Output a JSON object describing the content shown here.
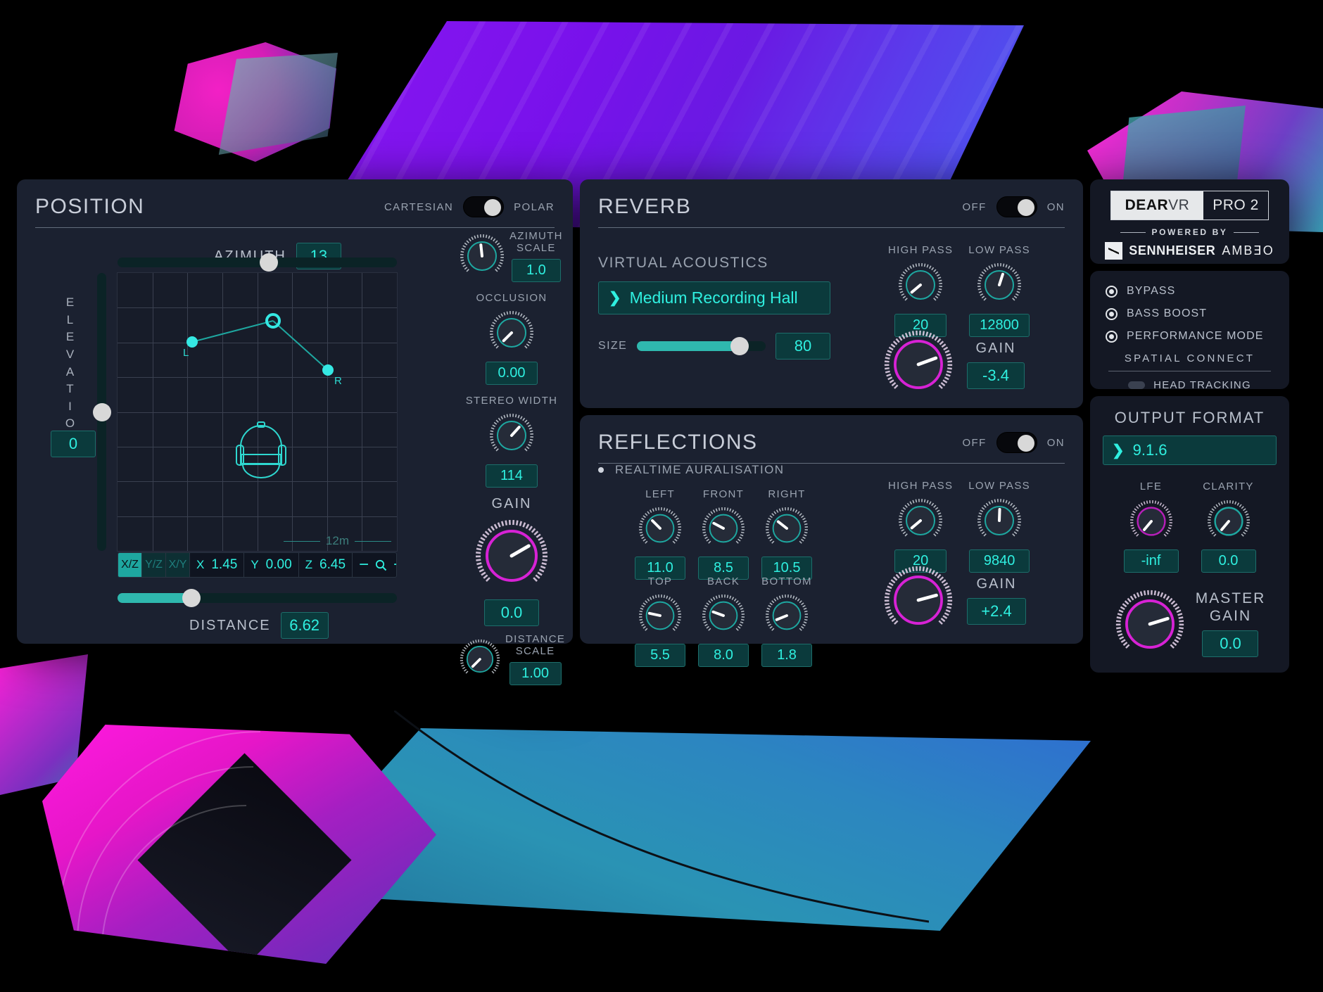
{
  "position": {
    "title": "POSITION",
    "mode_left": "CARTESIAN",
    "mode_right": "POLAR",
    "azimuth_label": "AZIMUTH",
    "azimuth_value": "13",
    "elevation_label": "ELEVATION",
    "elevation_value": "0",
    "distance_label": "DISTANCE",
    "distance_value": "6.62",
    "grid_scale_label": "12m",
    "marker_left": "L",
    "marker_right": "R",
    "planes": [
      {
        "label": "X/Z",
        "active": true
      },
      {
        "label": "Y/Z",
        "active": false
      },
      {
        "label": "X/Y",
        "active": false
      }
    ],
    "coords": [
      {
        "axis": "X",
        "value": "1.45"
      },
      {
        "axis": "Y",
        "value": "0.00"
      },
      {
        "axis": "Z",
        "value": "6.45"
      }
    ],
    "zoom_out": "−",
    "zoom_icon": "search-icon",
    "zoom_in": "+",
    "knobs": [
      {
        "label": "AZIMUTH\nSCALE",
        "value": "1.0",
        "color": "teal",
        "angle": -6,
        "label_first": true
      },
      {
        "label": "OCCLUSION",
        "value": "0.00",
        "color": "teal",
        "angle": -135,
        "label_first": true
      },
      {
        "label": "STEREO WIDTH",
        "value": "114",
        "color": "teal",
        "angle": 42,
        "label_first": true
      },
      {
        "label": "GAIN",
        "value": "0.0",
        "color": "magenta",
        "angle": 60,
        "label_first": true
      },
      {
        "label": "DISTANCE\nSCALE",
        "value": "1.00",
        "color": "teal",
        "angle": -135,
        "label_first": false
      }
    ]
  },
  "reverb": {
    "title": "REVERB",
    "off_label": "OFF",
    "on_label": "ON",
    "section_label": "VIRTUAL ACOUSTICS",
    "preset": "Medium Recording Hall",
    "size_label": "SIZE",
    "size_value": "80",
    "high_pass_label": "HIGH PASS",
    "high_pass_value": "20",
    "low_pass_label": "LOW PASS",
    "low_pass_value": "12800",
    "gain_label": "GAIN",
    "gain_value": "-3.4"
  },
  "reflections": {
    "title": "REFLECTIONS",
    "off_label": "OFF",
    "on_label": "ON",
    "realtime_label": "REALTIME AURALISATION",
    "knobs_row1": [
      {
        "label": "LEFT",
        "value": "11.0",
        "angle": -50
      },
      {
        "label": "FRONT",
        "value": "8.5",
        "angle": -62
      },
      {
        "label": "RIGHT",
        "value": "10.5",
        "angle": -55
      }
    ],
    "knobs_row2": [
      {
        "label": "TOP",
        "value": "5.5",
        "angle": -78
      },
      {
        "label": "BACK",
        "value": "8.0",
        "angle": -70
      },
      {
        "label": "BOTTOM",
        "value": "1.8",
        "angle": -110
      }
    ],
    "high_pass_label": "HIGH PASS",
    "high_pass_value": "20",
    "low_pass_label": "LOW PASS",
    "low_pass_value": "9840",
    "gain_label": "GAIN",
    "gain_value": "+2.4"
  },
  "brand": {
    "name_bold": "DEAR",
    "name_light": "VR",
    "edition": "PRO 2",
    "powered_by": "POWERED BY",
    "sennheiser": "SENNHEISER",
    "ambeo": "AMBEO"
  },
  "options": {
    "items": [
      {
        "label": "BYPASS"
      },
      {
        "label": "BASS BOOST"
      },
      {
        "label": "PERFORMANCE MODE"
      }
    ],
    "spatial_connect": "SPATIAL CONNECT",
    "head_tracking": "HEAD TRACKING"
  },
  "output": {
    "title": "OUTPUT FORMAT",
    "format": "9.1.6",
    "lfe_label": "LFE",
    "lfe_value": "-inf",
    "clarity_label": "CLARITY",
    "clarity_value": "0.0",
    "master_gain_label": "MASTER\nGAIN",
    "master_gain_value": "0.0"
  },
  "colors": {
    "teal": "#2ff0e0",
    "magenta": "#d722d5",
    "panel": "#1b2130",
    "panel_dark": "#141824"
  }
}
